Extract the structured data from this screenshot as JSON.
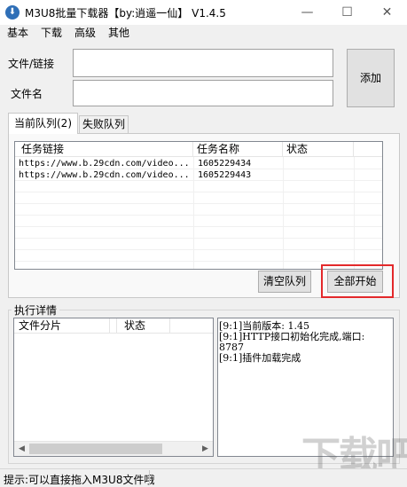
{
  "window": {
    "title": "M3U8批量下载器【by:逍遥一仙】  V1.4.5",
    "minimize": "—",
    "maximize": "☐",
    "close": "✕",
    "icon_glyph": "⬇"
  },
  "menu": [
    "基本",
    "下载",
    "高级",
    "其他"
  ],
  "form": {
    "file_link_label": "文件/链接",
    "file_link_value": "",
    "file_name_label": "文件名",
    "file_name_value": "",
    "add_button": "添加"
  },
  "tabs": {
    "current": "当前队列(2)",
    "failed": "失败队列"
  },
  "queue": {
    "columns": [
      "任务链接",
      "任务名称",
      "状态"
    ],
    "rows": [
      {
        "link": "https://www.b.29cdn.com/video...",
        "name": "1605229434",
        "status": ""
      },
      {
        "link": "https://www.b.29cdn.com/video...",
        "name": "1605229443",
        "status": ""
      }
    ],
    "clear_button": "清空队列",
    "start_all_button": "全部开始"
  },
  "details": {
    "group_title": "执行详情",
    "columns": [
      "文件分片",
      "状态"
    ],
    "log": [
      "[9:1]当前版本: 1.45",
      "[9:1]HTTP接口初始化完成,端口:",
      "8787",
      "[9:1]插件加载完成"
    ]
  },
  "status_bar": {
    "hint": "提示:可以直接拖入M3U8文件哦"
  },
  "watermark": "下载吧",
  "colors": {
    "highlight": "#e3292b",
    "window_bg": "#f0f0f0"
  }
}
